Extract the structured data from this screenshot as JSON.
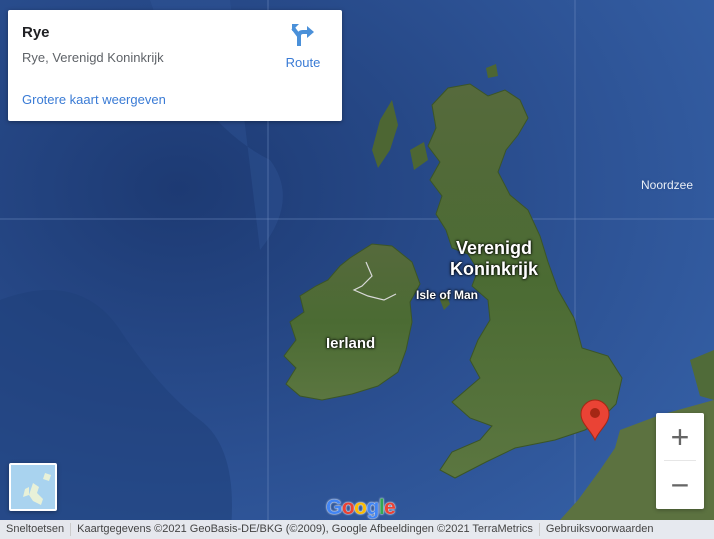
{
  "info_card": {
    "title": "Rye",
    "address": "Rye, Verenigd Koninkrijk",
    "route_label": "Route",
    "larger_map_link": "Grotere kaart weergeven"
  },
  "map_labels": {
    "country_line1": "Verenigd",
    "country_line2": "Koninkrijk",
    "isle_of_man": "Isle of Man",
    "ireland": "Ierland",
    "north_sea": "Noordzee"
  },
  "marker": {
    "place": "Rye",
    "color": "#ea4335"
  },
  "zoom_controls": {
    "zoom_in": "+",
    "zoom_out": "−"
  },
  "logo": {
    "letters": [
      "G",
      "o",
      "o",
      "g",
      "l",
      "e"
    ],
    "colors": [
      "#4285f4",
      "#ea4335",
      "#fbbc05",
      "#4285f4",
      "#34a853",
      "#ea4335"
    ]
  },
  "footer": {
    "shortcuts": "Sneltoetsen",
    "attribution": "Kaartgegevens ©2021 GeoBasis-DE/BKG (©2009), Google Afbeeldingen ©2021 TerraMetrics",
    "terms": "Gebruiksvoorwaarden"
  },
  "colors": {
    "sea": "#2b4f8d",
    "land": "#4c6a34",
    "link": "#3a7bd5"
  }
}
